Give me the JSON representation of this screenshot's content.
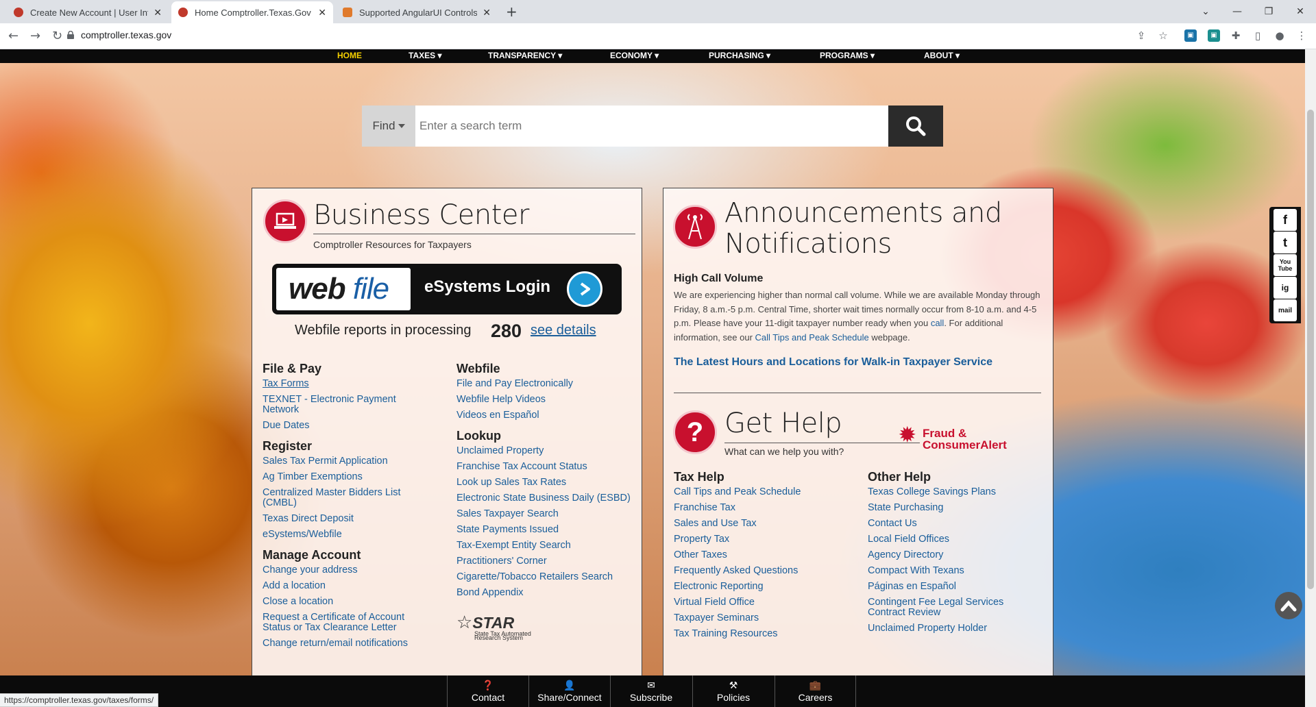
{
  "browser": {
    "tabs": [
      {
        "title": "Create New Account | User Inform",
        "close": "✕"
      },
      {
        "title": "Home Comptroller.Texas.Gov",
        "close": "✕"
      },
      {
        "title": "Supported AngularUI Controls | T",
        "close": "✕"
      }
    ],
    "new_tab": "+",
    "url": "comptroller.texas.gov",
    "status_url": "https://comptroller.texas.gov/taxes/forms/"
  },
  "site_nav": [
    "HOME",
    "TAXES ▾",
    "TRANSPARENCY ▾",
    "ECONOMY ▾",
    "PURCHASING ▾",
    "PROGRAMS ▾",
    "ABOUT ▾"
  ],
  "search": {
    "find_label": "Find",
    "placeholder": "Enter a search term"
  },
  "business_center": {
    "title": "Business Center",
    "subtitle": "Comptroller Resources for Taxpayers",
    "webfile_word1": "web",
    "webfile_word2": "file",
    "login_label": "eSystems Login",
    "processing_label": "Webfile reports in processing",
    "processing_count": "280",
    "details_link": "see details",
    "file_pay": {
      "heading": "File & Pay",
      "links": [
        "Tax Forms",
        "TEXNET - Electronic Payment Network",
        "Due Dates"
      ]
    },
    "register": {
      "heading": "Register",
      "links": [
        "Sales Tax Permit Application",
        "Ag Timber Exemptions",
        "Centralized Master Bidders List (CMBL)",
        "Texas Direct Deposit",
        "eSystems/Webfile"
      ]
    },
    "manage": {
      "heading": "Manage Account",
      "links": [
        "Change your address",
        "Add a location",
        "Close a location",
        "Request a Certificate of Account Status or Tax Clearance Letter",
        "Change return/email notifications"
      ]
    },
    "webfile": {
      "heading": "Webfile",
      "links": [
        "File and Pay Electronically",
        "Webfile Help Videos",
        "Videos en Español"
      ]
    },
    "lookup": {
      "heading": "Lookup",
      "links": [
        "Unclaimed Property",
        "Franchise Tax Account Status",
        "Look up Sales Tax Rates",
        "Electronic State Business Daily (ESBD)",
        "Sales Taxpayer Search",
        "State Payments Issued",
        "Tax-Exempt Entity Search",
        "Practitioners' Corner",
        "Cigarette/Tobacco Retailers Search",
        "Bond Appendix"
      ]
    },
    "star_title": "STAR",
    "star_sub1": "State Tax Automated",
    "star_sub2": "Research System"
  },
  "announcements": {
    "title1": "Announcements and",
    "title2": "Notifications",
    "notice_heading": "High Call Volume",
    "notice_p1": "We are experiencing higher than normal call volume. While we are available Monday through Friday, 8 a.m.-5 p.m. Central Time, shorter wait times normally occur from 8-10 a.m. and 4-5 p.m. Please have your 11-digit taxpayer number ready when you ",
    "notice_call": "call",
    "notice_p2": ". For additional information, see our ",
    "notice_tips": "Call Tips and Peak Schedule",
    "notice_p3": " webpage.",
    "hours_link": "The Latest Hours and Locations for Walk-in Taxpayer Service",
    "help_title": "Get Help",
    "help_sub": "What can we help you with?",
    "fraud_line1": "Fraud &",
    "fraud_line2": "ConsumerAlert",
    "tax_help": {
      "heading": "Tax Help",
      "links": [
        "Call Tips and Peak Schedule",
        "Franchise Tax",
        "Sales and Use Tax",
        "Property Tax",
        "Other Taxes",
        "Frequently Asked Questions",
        "Electronic Reporting",
        "Virtual Field Office",
        "Taxpayer Seminars",
        "Tax Training Resources"
      ]
    },
    "other_help": {
      "heading": "Other Help",
      "links": [
        "Texas College Savings Plans",
        "State Purchasing",
        "Contact Us",
        "Local Field Offices",
        "Agency Directory",
        "Compact With Texans",
        "Páginas en Español",
        "Contingent Fee Legal Services Contract Review",
        "Unclaimed Property Holder"
      ]
    }
  },
  "social": [
    "f",
    "t",
    "You Tube",
    "ig",
    "mail"
  ],
  "footer": [
    "Contact",
    "Share/Connect",
    "Subscribe",
    "Policies",
    "Careers"
  ],
  "colors": {
    "brand_red": "#c8102e",
    "link_blue": "#1a5e9a",
    "nav_black": "#0b0b0b",
    "home_yellow": "#f5d000"
  }
}
